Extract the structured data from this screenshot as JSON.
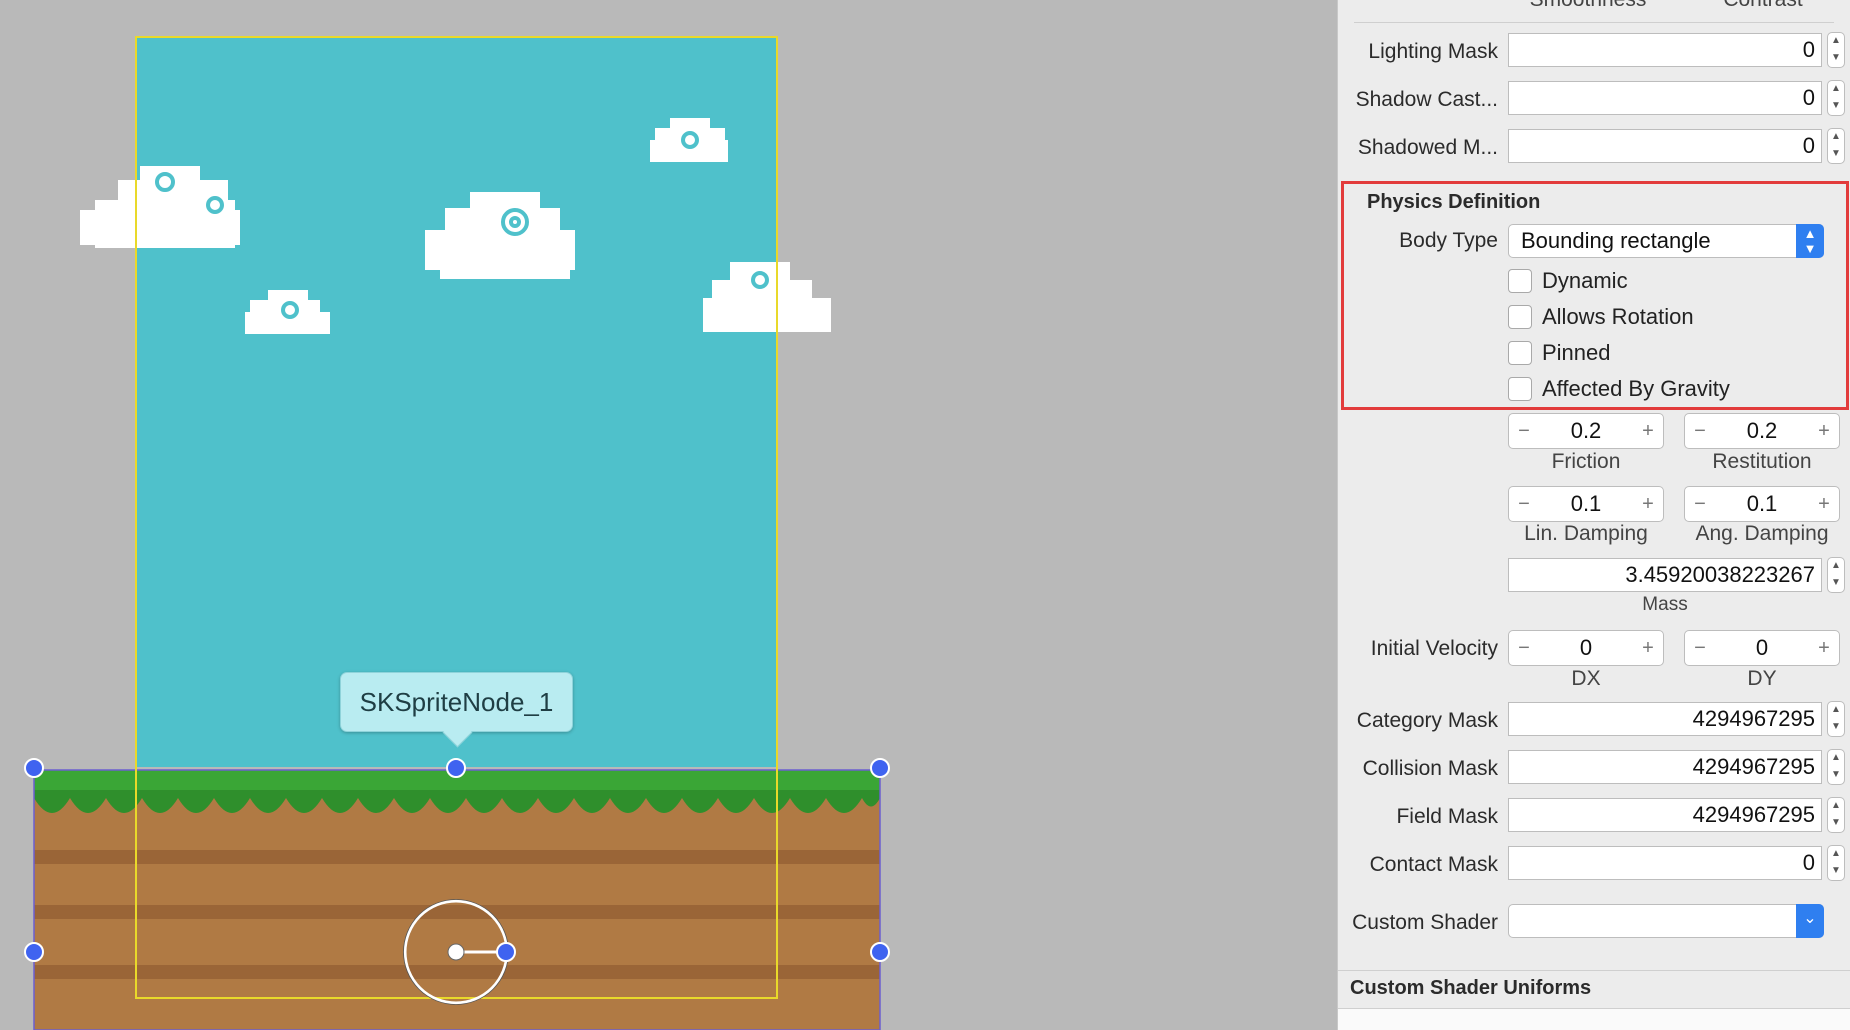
{
  "scene": {
    "selected_node_label": "SKSpriteNode_1",
    "colors": {
      "sky": "#4fc1cb",
      "grass": "#3aa636",
      "dirt": "#b07a44",
      "selection": "#3f63f0",
      "frame": "#e9d92a"
    }
  },
  "inspector": {
    "top_partial": {
      "smoothness_label": "Smoothness",
      "contrast_label": "Contrast"
    },
    "mask_rows_top": [
      {
        "label": "Lighting Mask",
        "value": "0"
      },
      {
        "label": "Shadow Cast...",
        "value": "0"
      },
      {
        "label": "Shadowed M...",
        "value": "0"
      }
    ],
    "physics": {
      "section_title": "Physics Definition",
      "body_type_label": "Body Type",
      "body_type_value": "Bounding rectangle",
      "checkboxes": [
        {
          "label": "Dynamic",
          "checked": false
        },
        {
          "label": "Allows Rotation",
          "checked": false
        },
        {
          "label": "Pinned",
          "checked": false
        },
        {
          "label": "Affected By Gravity",
          "checked": false
        }
      ],
      "friction": {
        "value": "0.2",
        "label": "Friction"
      },
      "restitution": {
        "value": "0.2",
        "label": "Restitution"
      },
      "lin_damping": {
        "value": "0.1",
        "label": "Lin. Damping"
      },
      "ang_damping": {
        "value": "0.1",
        "label": "Ang. Damping"
      },
      "mass": {
        "value": "3.45920038223267",
        "label": "Mass"
      },
      "initial_velocity": {
        "label": "Initial Velocity",
        "dx_value": "0",
        "dx_label": "DX",
        "dy_value": "0",
        "dy_label": "DY"
      },
      "masks": [
        {
          "label": "Category Mask",
          "value": "4294967295"
        },
        {
          "label": "Collision Mask",
          "value": "4294967295"
        },
        {
          "label": "Field Mask",
          "value": "4294967295"
        },
        {
          "label": "Contact Mask",
          "value": "0"
        }
      ],
      "custom_shader_label": "Custom Shader",
      "custom_shader_value": ""
    },
    "uniforms_title": "Custom Shader Uniforms",
    "stepper_symbols": {
      "minus": "−",
      "plus": "+",
      "up": "▲",
      "down": "▼"
    }
  }
}
